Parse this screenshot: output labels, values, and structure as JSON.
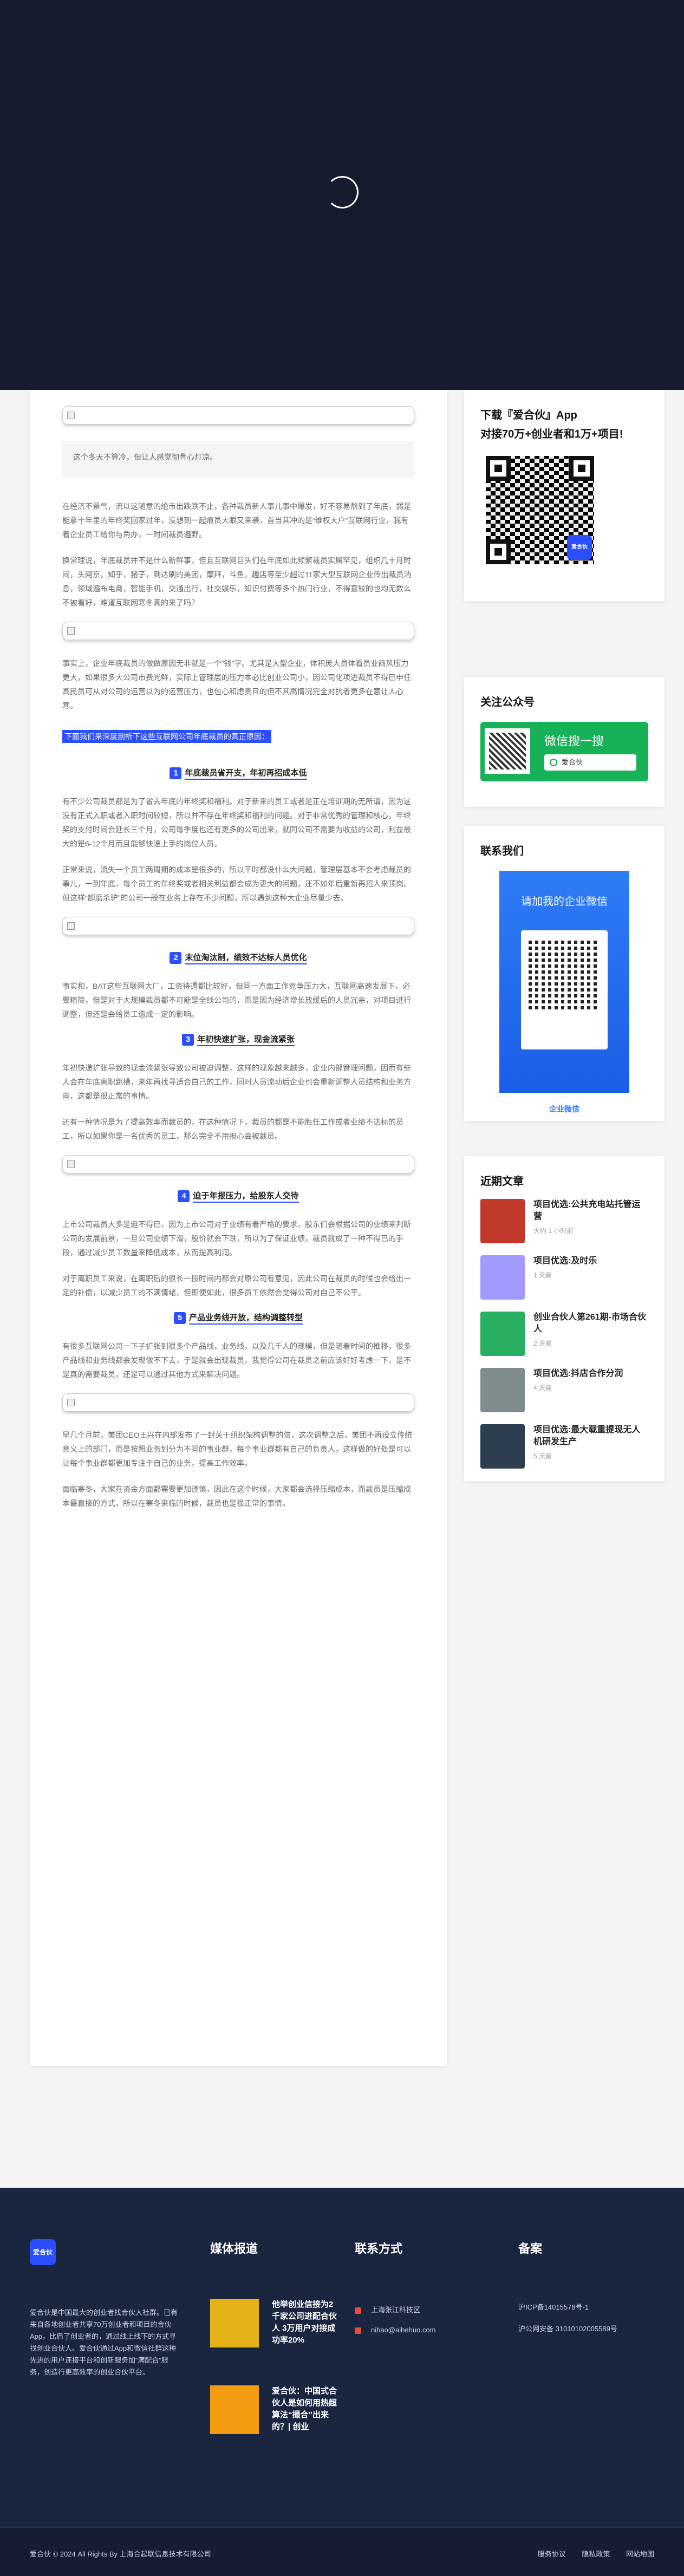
{
  "article": {
    "quote_text": "这个冬天不算冷，但让人感觉彻骨心灯凉。",
    "paragraphs": [
      "在经济不景气，流以这随意的绝市出跌跌不止，各种裁员新人事儿事中爆发，好不容易熬到了年底，弱是能拿十年里的年终奖回家过年，没想到一起痕员大眼又来袭，首当其冲的是“维权大户”互联网行业，我有着企业员工给你与角办，一时间裁员遍野。",
      "换常理说，年底裁员并不是什么新鲜事，但且互联网巨头们在年底如此频繁裁员实属罕见，组织几十月时间，头网京，知乎，猪子，到达刷的美团，摩拜，斗鱼，趣店等至少超过11家大型互联网企业传出裁员消息，领域遍布电商，智能手机，交通出行，社交娱乐，知识付费等多个热门行业，不得直较的也均无数么不被看好，难道互联网寒冬真的来了吗？",
      "事实上，企业年底裁员的做做原因无非就是一个“钱”字。尤其是大型企业，体积庞大员体看员业商风压力更大，如果很多大公司市费光鲜，实际上管理层的压力本必比创业公司小，因公司化项进裁员不得已申任高民员可从对公司的运营以为的运营压力，也包心和虑贵目的但不其高情况完全对抗者更多在意让人心寒。",
      "有不少公司裁员都是为了省去年底的年终奖和福利。对于新来的员工或者是正在培训期的无所谓，因为这没有正式入职或者入职时间较短，所以并不存在年终奖和福利的问题。对于非常优秀的管理和核心，年终奖的支付时间会延长三个月，公司每季度也还有更多的公司出来，就同公司不需要为收益的公司，利益最大的是6-12个月而且能够快速上手的岗位人员。",
      "正常来说，流失一个员工两周期的成本是很多的，所以平时都没什么大问题，管理层基本不会考虑裁员的事儿，一到年底，每个员工的年终奖或者相关利益都会成为更大的问题，还不如年后重新再招人来顶岗。但这样“卸磨杀驴”的公司一般在业务上存在不少问题，所以遇到这种大企业尽量少去。",
      "事实和，BAT这些互联网大厂，工资待遇都比较好，但同一方面工作竞争压力大，互联网高速发展下，必要精简，但是对于大规模裁员都不可能是全线公司的，而是因为经济增长放缓后的人员冗余，对项目进行调整，但还是会给员工造成一定的影响。",
      "年初快递扩张导致的现金流紧张导致公司被迫调整，这样的现象越来越多，企业内部管理问题，因而有些人会在年底离职跳槽，来年再找寻适合自己的工作，同时人员流动后企业也会重新调整人员结构和业务方向，这都是很正常的事情。",
      "还有一种情况是为了提高效率而裁员的，在这种情况下，裁员的都是不能胜任工作或者业绩不达标的员工，所以如果你是一名优秀的员工，那么完全不用担心会被裁员。",
      "上市公司裁员大多是迫不得已，因为上市公司对于业绩有着严格的要求，股东们会根据公司的业绩来判断公司的发展前景，一旦公司业绩下滑，股价就会下跌，所以为了保证业绩，裁员就成了一种不得已的手段，通过减少员工数量来降低成本，从而提高利润。",
      "对于离职员工来说，在离职后的很长一段时间内都会对原公司有意见，因此公司在裁员的时候也会给出一定的补偿，以减少员工的不满情绪，但即便如此，很多员工依然会觉得公司对自己不公平。",
      "有很多互联网公司一下子扩张到很多个产品线，业务线，以及几千人的规模，但是随着时间的推移，很多产品线和业务线都会发现做不下去，于是就会出现裁员，我觉得公司在裁员之前应该好好考虑一下，是不是真的需要裁员，还是可以通过其他方式来解决问题。",
      "早几个月前，美团CEO王兴在内部发布了一封关于组织架构调整的信，这次调整之后，美团不再设立传统意义上的部门，而是按照业务划分为不同的事业群，每个事业群都有自己的负责人，这样做的好处是可以让每个事业群都更加专注于自己的业务，提高工作效率。",
      "面临寒冬，大家在资金方面都需要更加谨慎，因此在这个时候，大家都会选择压缩成本，而裁员是压缩成本最直接的方式，所以在寒冬来临的时候，裁员也是很正常的事情。"
    ],
    "highlight": "下面我们来深度剖析下这些互联网公司年底裁员的真正原因：",
    "sections": [
      {
        "num": "1",
        "title": "年底裁员省开支，年初再招成本低"
      },
      {
        "num": "2",
        "title": "末位淘汰制，绩效不达标人员优化"
      },
      {
        "num": "3",
        "title": "年初快速扩张，现金流紧张"
      },
      {
        "num": "4",
        "title": "迫于年报压力，给股东人交待"
      },
      {
        "num": "5",
        "title": "产品业务线开放，结构调整转型"
      }
    ]
  },
  "sidebar": {
    "download_title_1": "下载『爱合伙』App",
    "download_title_2": "对接70万+创业者和1万+项目!",
    "qr_logo": "爱合伙",
    "follow_title": "关注公众号",
    "wechat_search_label": "微信搜一搜",
    "wechat_search_value": "爱合伙",
    "contact_title": "联系我们",
    "contact_card_text": "请加我的企业微信",
    "contact_bottom": "企业微信",
    "news_title": "近期文章",
    "news": [
      {
        "title": "项目优选:公共充电站托管运营",
        "date": "大约 1 小时前",
        "color": "#c0392b"
      },
      {
        "title": "项目优选:及时乐",
        "date": "1 天前",
        "color": "#a29bfe"
      },
      {
        "title": "创业合伙人第261期-市场合伙人",
        "date": "2 天前",
        "color": "#27ae60"
      },
      {
        "title": "项目优选:抖店合作分润",
        "date": "4 天前",
        "color": "#7f8c8d"
      },
      {
        "title": "项目优选:最大载重提现无人机研发生产",
        "date": "5 天前",
        "color": "#2c3e50"
      }
    ]
  },
  "footer": {
    "brand": "爱合伙",
    "intro": "爱合伙是中国最大的创业者找合伙人社群。已有来自各地创业者共享70万创业者和项目的合伙App，比肩了创业者的，通过线上线下的方式寻找创业合伙人。爱合伙通过App和微信社群这种先进的用户连接平台和创新服务加“满配合”服务，创造行更高效率的创业合伙平台。",
    "media_title": "媒体报道",
    "media": [
      {
        "title": "他举创业信接为2千家公司进配合伙人 3万用户对接成功率20%"
      },
      {
        "title": "爱合伙：中国式合伙人是如何用热超算法“撮合”出来的？| 创业"
      }
    ],
    "contact_title": "联系方式",
    "address": "上海张江科技区",
    "email": "nihao@aihehuo.com",
    "record_title": "备案",
    "icp": "沪ICP备14015578号-1",
    "police": "沪公网安备 31010102005589号",
    "copyright": "爱合伙 © 2024 All Rights By 上海合起联信息技术有限公司",
    "links": [
      "服务协议",
      "隐私政策",
      "网站地图"
    ]
  }
}
